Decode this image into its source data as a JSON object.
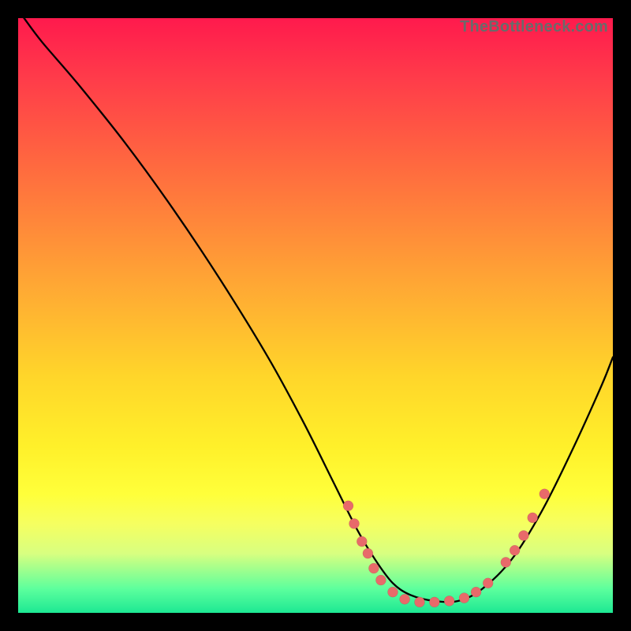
{
  "watermark": "TheBottleneck.com",
  "chart_data": {
    "type": "line",
    "title": "",
    "xlabel": "",
    "ylabel": "",
    "xlim": [
      0,
      100
    ],
    "ylim": [
      0,
      100
    ],
    "grid": false,
    "legend": false,
    "series": [
      {
        "name": "curve",
        "x": [
          1,
          4,
          10,
          18,
          26,
          34,
          42,
          48,
          53,
          57,
          60,
          63,
          66,
          70,
          74,
          78,
          83,
          88,
          93,
          98,
          100
        ],
        "y": [
          100,
          96,
          89,
          79,
          68,
          56,
          43,
          32,
          22,
          14,
          9,
          5,
          3,
          2,
          2,
          4,
          9,
          17,
          27,
          38,
          43
        ]
      }
    ],
    "points": [
      {
        "x": 55.5,
        "y": 18
      },
      {
        "x": 56.5,
        "y": 15
      },
      {
        "x": 57.8,
        "y": 12
      },
      {
        "x": 58.8,
        "y": 10
      },
      {
        "x": 59.8,
        "y": 7.5
      },
      {
        "x": 61.0,
        "y": 5.5
      },
      {
        "x": 63.0,
        "y": 3.5
      },
      {
        "x": 65.0,
        "y": 2.3
      },
      {
        "x": 67.5,
        "y": 1.8
      },
      {
        "x": 70.0,
        "y": 1.8
      },
      {
        "x": 72.5,
        "y": 2.0
      },
      {
        "x": 75.0,
        "y": 2.5
      },
      {
        "x": 77.0,
        "y": 3.5
      },
      {
        "x": 79.0,
        "y": 5.0
      },
      {
        "x": 82.0,
        "y": 8.5
      },
      {
        "x": 83.5,
        "y": 10.5
      },
      {
        "x": 85.0,
        "y": 13
      },
      {
        "x": 86.5,
        "y": 16
      },
      {
        "x": 88.5,
        "y": 20
      }
    ],
    "colors": {
      "gradient_top": "#ff1a4d",
      "gradient_mid": "#ffd52a",
      "gradient_bottom": "#1de893",
      "curve": "#000000",
      "points": "#e86a6a"
    }
  }
}
